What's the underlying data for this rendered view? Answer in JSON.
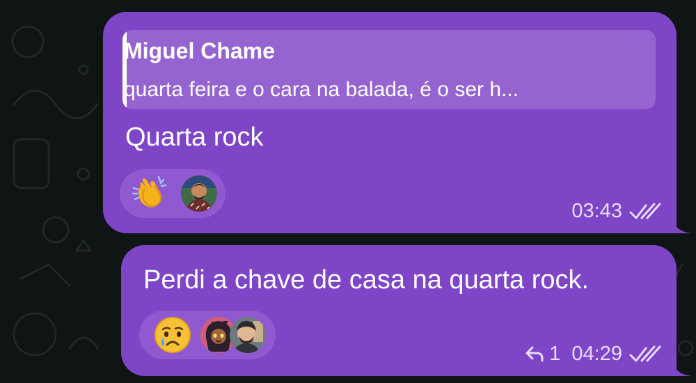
{
  "colors": {
    "bubble": "#7e45c6",
    "reply_quote_bg": "#9564d1",
    "reaction_pill": "#9059cf",
    "background": "#0f1414",
    "meta_text": "#eadcfb"
  },
  "messages": [
    {
      "reply_to": {
        "author": "Miguel Chame",
        "text": "quarta feira e o cara na balada, é o ser h..."
      },
      "text": "Quarta rock",
      "reactions": [
        {
          "icon": "clapping-hands-emoji",
          "avatars": [
            "user-avatar"
          ]
        }
      ],
      "time": "03:43",
      "status_icon": "double-check-icon"
    },
    {
      "text": "Perdi a chave de casa na quarta rock.",
      "reactions": [
        {
          "icon": "crying-face-emoji",
          "avatars": [
            "user-avatar",
            "user-avatar"
          ]
        }
      ],
      "reply_icon": "reply-arrow-icon",
      "reply_count": "1",
      "time": "04:29",
      "status_icon": "double-check-icon"
    }
  ]
}
